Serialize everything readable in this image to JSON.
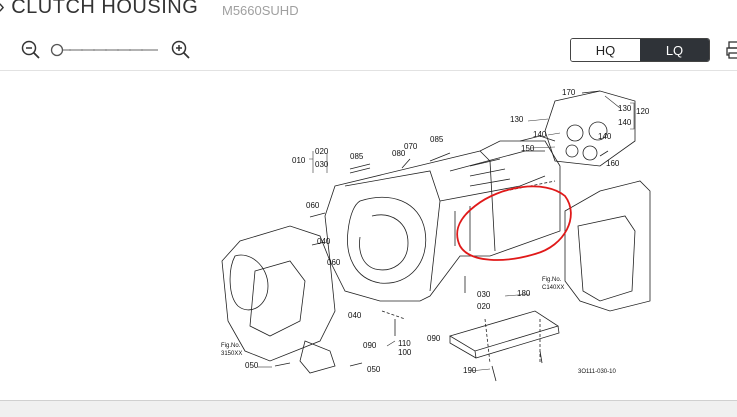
{
  "header": {
    "title": "CLUTCH HOUSING",
    "model": "M5660SUHD"
  },
  "toolbar": {
    "zoom_out_icon": "zoom-out-icon",
    "zoom_in_icon": "zoom-in-icon",
    "quality": {
      "options": [
        "HQ",
        "LQ"
      ],
      "selected": "LQ"
    },
    "print_icon": "print-icon"
  },
  "diagram": {
    "part_numbers": [
      "010",
      "020",
      "030",
      "040",
      "050",
      "060",
      "070",
      "080",
      "085",
      "090",
      "100",
      "110",
      "120",
      "130",
      "140",
      "150",
      "160",
      "170",
      "180",
      "190"
    ],
    "fig_refs": {
      "left_line1": "Fig.No.",
      "left_line2": "3150XX",
      "right_line1": "Fig.No.",
      "right_line2": "C140XX"
    },
    "drawing_code": "3O111-030-10",
    "annotation_color": "#e01919"
  }
}
